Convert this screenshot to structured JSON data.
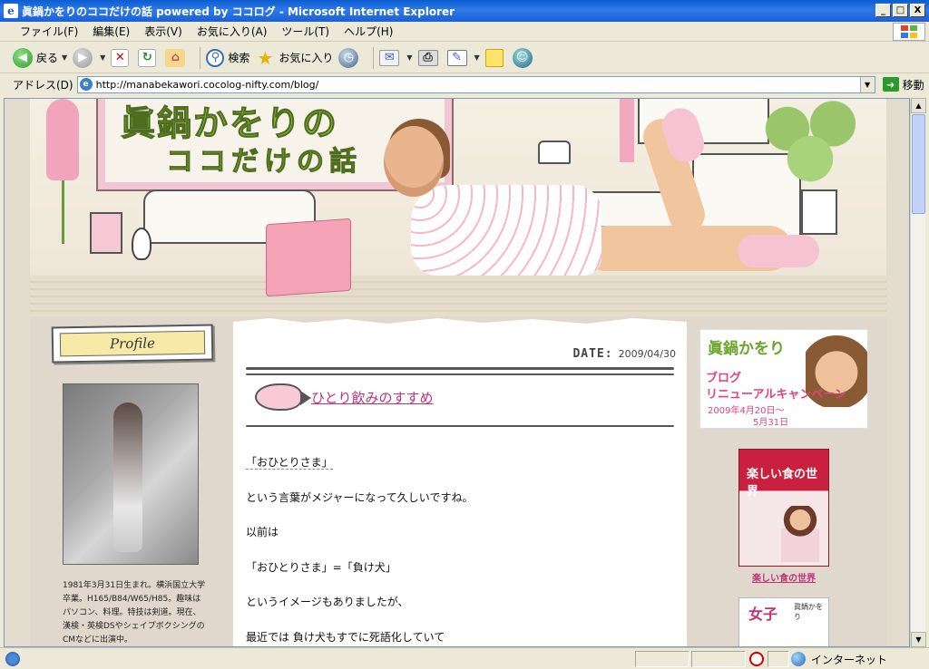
{
  "window": {
    "title": "眞鍋かをりのココだけの話 powered by ココログ - Microsoft Internet Explorer",
    "minimize": "_",
    "maximize": "□",
    "close": "X"
  },
  "menu": {
    "items": [
      {
        "label": "ファイル(F)"
      },
      {
        "label": "編集(E)"
      },
      {
        "label": "表示(V)"
      },
      {
        "label": "お気に入り(A)"
      },
      {
        "label": "ツール(T)"
      },
      {
        "label": "ヘルプ(H)"
      }
    ]
  },
  "toolbar": {
    "back_label": "戻る",
    "search_label": "検索",
    "favorites_label": "お気に入り"
  },
  "address": {
    "label": "アドレス(D)",
    "url": "http://manabekawori.cocolog-nifty.com/blog/",
    "go_label": "移動"
  },
  "sidebar_left": {
    "profile_heading": "Profile",
    "profile_text": "1981年3月31日生まれ。横浜国立大学卒業。H165/B84/W65/H85。趣味はパソコン、料理。特技は剣道。現在、漢検・英検DSやシェイプボクシングのCMなどに出演中。"
  },
  "entry": {
    "date_label": "DATE:",
    "date": "2009/04/30",
    "title": "ひとり飲みのすすめ",
    "paragraphs": [
      "「おひとりさま」",
      "という言葉がメジャーになって久しいですね。",
      "以前は",
      "「おひとりさま」=「負け犬」",
      "というイメージもありましたが、",
      "最近では 負け犬もすでに死語化していて"
    ]
  },
  "sidebar_right": {
    "campaign": {
      "name": "眞鍋かをり",
      "line1": "ブログ",
      "line2": "リニューアルキャンペーン",
      "line3": "2009年4月20日〜",
      "line4": "5月31日"
    },
    "book1_title": "楽しい食の世界",
    "book1_link": "楽しい食の世界",
    "book2_title": "女子",
    "book2_author": "眞鍋かをり"
  },
  "status": {
    "zone": "インターネット"
  }
}
